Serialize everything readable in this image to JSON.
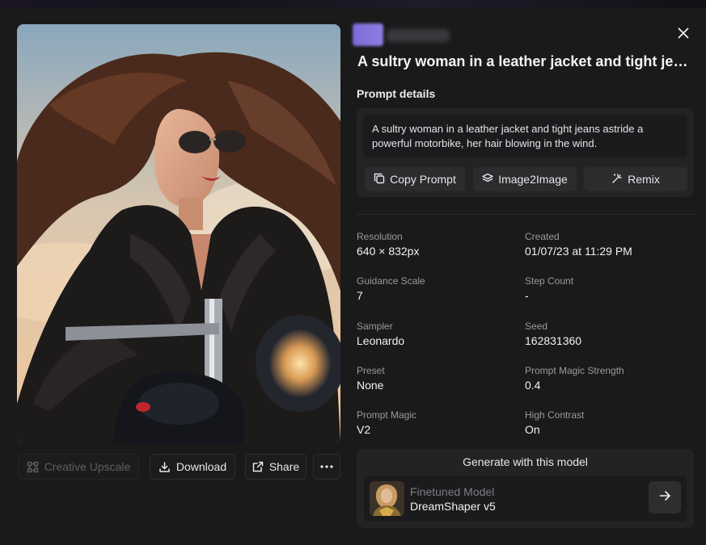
{
  "title": "A sultry woman in a leather jacket and tight jeans astride a powerful motorbike, her hair blowing in the wind.",
  "prompt_section": {
    "label": "Prompt details",
    "text": "A sultry woman in a leather jacket and tight jeans astride a powerful motorbike, her hair blowing in the wind.",
    "copy_label": "Copy Prompt",
    "image2image_label": "Image2Image",
    "remix_label": "Remix"
  },
  "image_actions": {
    "upscale_label": "Creative Upscale",
    "download_label": "Download",
    "share_label": "Share"
  },
  "meta": {
    "resolution": {
      "label": "Resolution",
      "value": "640 × 832px"
    },
    "created": {
      "label": "Created",
      "value": "01/07/23 at 11:29 PM"
    },
    "guidance": {
      "label": "Guidance Scale",
      "value": "7"
    },
    "steps": {
      "label": "Step Count",
      "value": "-"
    },
    "sampler": {
      "label": "Sampler",
      "value": "Leonardo"
    },
    "seed": {
      "label": "Seed",
      "value": "162831360"
    },
    "preset": {
      "label": "Preset",
      "value": "None"
    },
    "pm_strength": {
      "label": "Prompt Magic Strength",
      "value": "0.4"
    },
    "prompt_magic": {
      "label": "Prompt Magic",
      "value": "V2"
    },
    "contrast": {
      "label": "High Contrast",
      "value": "On"
    }
  },
  "generate": {
    "title": "Generate with this model",
    "model_kind": "Finetuned Model",
    "model_name": "DreamShaper v5"
  },
  "icons": {
    "close": "close-icon",
    "copy": "copy-icon",
    "layers": "layers-icon",
    "remix": "magic-wand-icon",
    "upscale": "upscale-grid-icon",
    "download": "download-icon",
    "share": "external-link-icon",
    "more": "more-horizontal-icon",
    "arrow": "arrow-right-icon"
  }
}
